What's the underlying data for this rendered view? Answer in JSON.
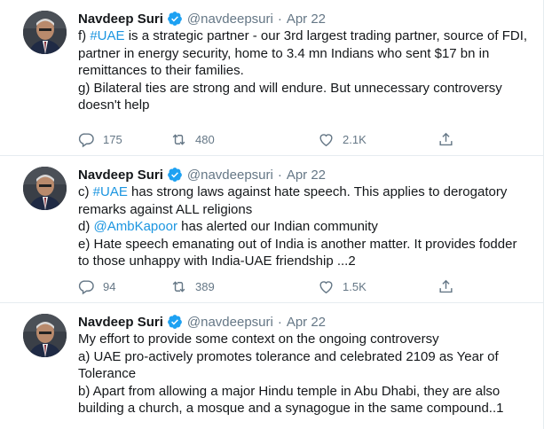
{
  "tweets": [
    {
      "name": "Navdeep Suri",
      "handle": "@navdeepsuri",
      "separator": "·",
      "date": "Apr 22",
      "lines": [
        [
          {
            "text": "f) "
          },
          {
            "text": "#UAE",
            "link": true
          },
          {
            "text": " is a strategic partner - our 3rd largest trading partner, source of FDI,"
          }
        ],
        [
          {
            "text": "partner in energy security, home to 3.4 mn Indians who sent $17 bn in"
          }
        ],
        [
          {
            "text": "remittances to their families."
          }
        ],
        [
          {
            "text": "g) Bilateral ties are strong and will endure. But unnecessary controversy"
          }
        ],
        [
          {
            "text": "doesn't help"
          }
        ]
      ],
      "replies": "175",
      "retweets": "480",
      "likes": "2.1K"
    },
    {
      "name": "Navdeep Suri",
      "handle": "@navdeepsuri",
      "separator": "·",
      "date": "Apr 22",
      "lines": [
        [
          {
            "text": "c) "
          },
          {
            "text": "#UAE",
            "link": true
          },
          {
            "text": " has strong laws against hate speech. This applies to derogatory"
          }
        ],
        [
          {
            "text": "remarks against ALL religions"
          }
        ],
        [
          {
            "text": "d) "
          },
          {
            "text": "@AmbKapoor",
            "link": true
          },
          {
            "text": " has alerted our Indian community"
          }
        ],
        [
          {
            "text": "e) Hate speech emanating out of India is another matter. It provides fodder"
          }
        ],
        [
          {
            "text": "to those unhappy with India-UAE friendship ...2"
          }
        ]
      ],
      "replies": "94",
      "retweets": "389",
      "likes": "1.5K"
    },
    {
      "name": "Navdeep Suri",
      "handle": "@navdeepsuri",
      "separator": "·",
      "date": "Apr 22",
      "lines": [
        [
          {
            "text": "My effort to provide some context on the ongoing controversy"
          }
        ],
        [
          {
            "text": "a) UAE pro-actively promotes tolerance and celebrated 2109 as Year of"
          }
        ],
        [
          {
            "text": "Tolerance"
          }
        ],
        [
          {
            "text": "b) Apart from allowing a major Hindu temple in Abu Dhabi, they are also"
          }
        ],
        [
          {
            "text": "building a church, a mosque and a synagogue in the same compound..1"
          }
        ]
      ],
      "replies": "",
      "retweets": "",
      "likes": ""
    }
  ],
  "colors": {
    "link": "#1b95e0",
    "muted": "#657786",
    "verified": "#1da1f2",
    "divider": "#e6ecf0"
  },
  "icons": [
    "verified-badge-icon",
    "reply-icon",
    "retweet-icon",
    "like-icon",
    "share-icon"
  ]
}
